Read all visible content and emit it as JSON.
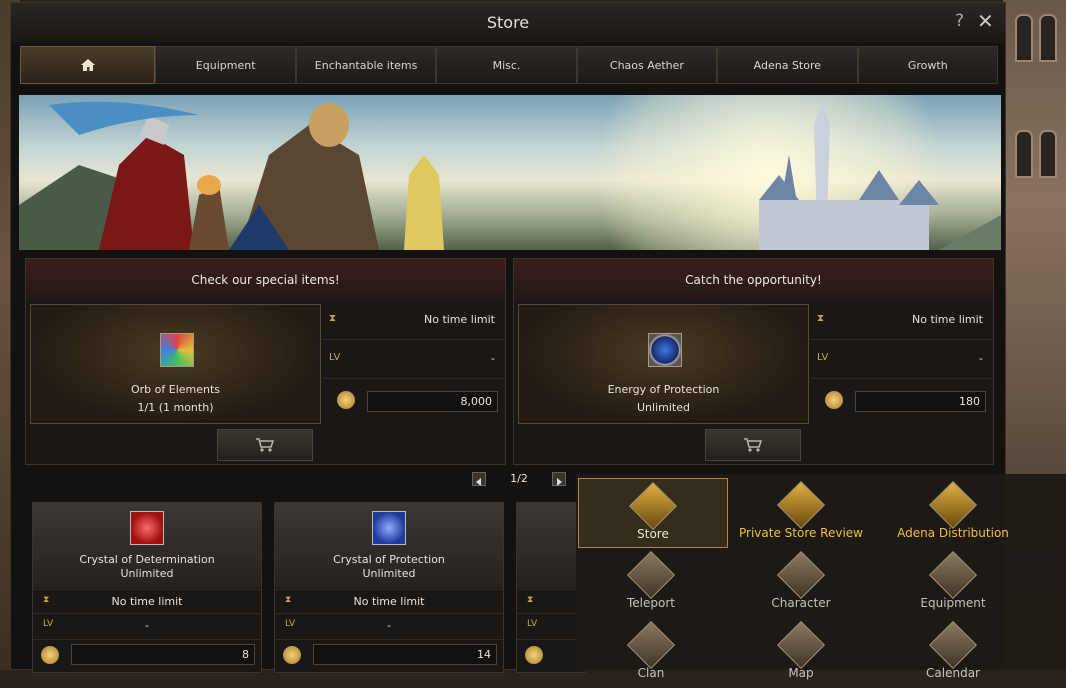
{
  "window": {
    "title": "Store"
  },
  "tabs": [
    "Equipment",
    "Enchantable items",
    "Misc.",
    "Chaos Aether",
    "Adena Store",
    "Growth"
  ],
  "promos": [
    {
      "header": "Check our special items!",
      "item_name": "Orb of Elements",
      "item_sub": "1/1 (1 month)",
      "time_limit": "No time limit",
      "level": "-",
      "price": "8,000"
    },
    {
      "header": "Catch the opportunity!",
      "item_name": "Energy of Protection",
      "item_sub": "Unlimited",
      "time_limit": "No time limit",
      "level": "-",
      "price": "180"
    }
  ],
  "pager": {
    "text": "1/2"
  },
  "level_label": "LV",
  "cards": [
    {
      "name": "Crystal of Determination",
      "sub": "Unlimited",
      "time_limit": "No time limit",
      "level": "-",
      "price": "8"
    },
    {
      "name": "Crystal of Protection",
      "sub": "Unlimited",
      "time_limit": "No time limit",
      "level": "-",
      "price": "14"
    }
  ],
  "menu": {
    "items": [
      "Store",
      "Private Store Review",
      "Adena Distribution",
      "Teleport",
      "Character",
      "Equipment",
      "Clan",
      "Map",
      "Calendar"
    ]
  }
}
